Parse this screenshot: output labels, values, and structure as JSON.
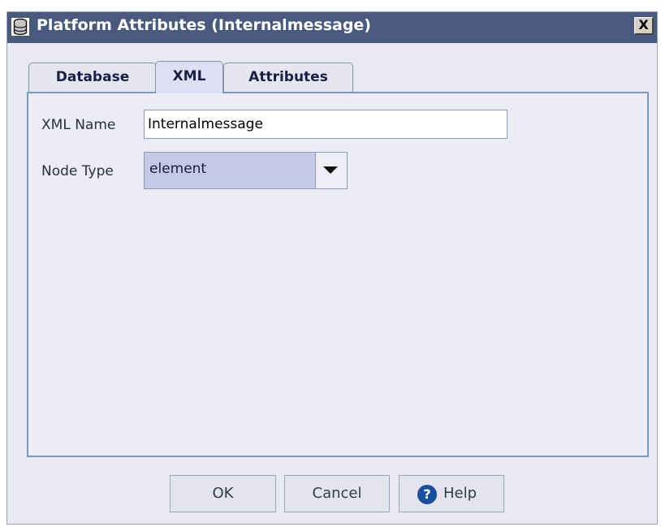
{
  "window": {
    "title": "Platform Attributes (Internalmessage)",
    "close_glyph": "X",
    "icon": "database-icon"
  },
  "tabs": [
    {
      "label": "Database",
      "active": false
    },
    {
      "label": "XML",
      "active": true
    },
    {
      "label": "Attributes",
      "active": false
    }
  ],
  "form": {
    "xml_name_label": "XML Name",
    "xml_name_value": "Internalmessage",
    "node_type_label": "Node Type",
    "node_type_value": "element"
  },
  "buttons": {
    "ok_label": "OK",
    "cancel_label": "Cancel",
    "help_label": "Help",
    "help_icon_glyph": "?"
  },
  "colors": {
    "titlebar": "#4a5a7f",
    "dialog_bg": "#e9e9f4",
    "panel_border": "#7a9ac4",
    "select_bg": "#c3c9e7"
  }
}
